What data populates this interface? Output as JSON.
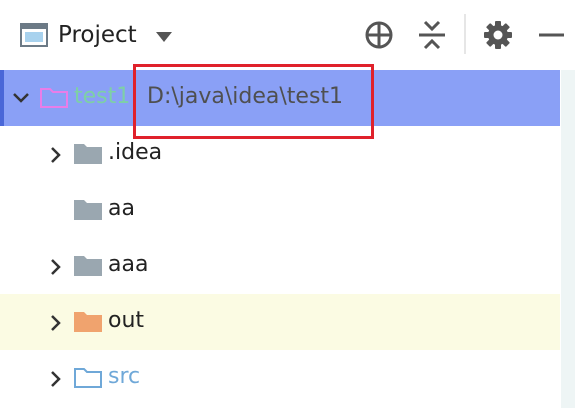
{
  "header": {
    "title": "Project",
    "icons": [
      "project-window-icon",
      "dropdown-arrow-icon",
      "locate-icon",
      "collapse-all-icon",
      "gear-icon",
      "minimize-icon"
    ]
  },
  "tree": {
    "root": {
      "name": "test1",
      "path": "D:\\java\\idea\\test1",
      "expanded": true,
      "selected": true
    },
    "children": [
      {
        "name": ".idea",
        "expandable": true,
        "folder_color": "#9aa7b0"
      },
      {
        "name": "aa",
        "expandable": false,
        "folder_color": "#9aa7b0"
      },
      {
        "name": "aaa",
        "expandable": true,
        "folder_color": "#9aa7b0"
      },
      {
        "name": "out",
        "expandable": true,
        "folder_color": "#f0a36e",
        "excluded": true
      },
      {
        "name": "src",
        "expandable": true,
        "folder_color": "#6fa8d8",
        "outline": true
      }
    ]
  },
  "colors": {
    "selection": "#8aa0f6",
    "excluded_row": "#fbfbe3",
    "annotation_box": "#e0212b",
    "module_text": "#7ed0a6"
  }
}
